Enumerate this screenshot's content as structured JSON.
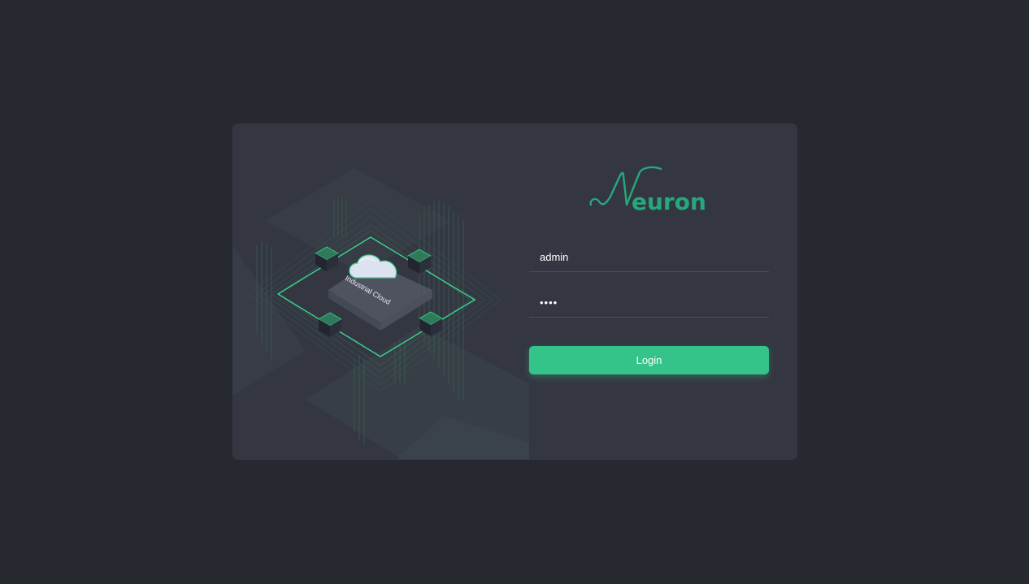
{
  "app": {
    "logo_text": "Neuron",
    "brand_color": "#34c388"
  },
  "illustration": {
    "label": "Industrial Cloud"
  },
  "login_form": {
    "username_value": "admin",
    "password_value": "••••",
    "login_label": "Login"
  },
  "colors": {
    "background": "#272930",
    "card": "#343742",
    "accent": "#34c388"
  }
}
